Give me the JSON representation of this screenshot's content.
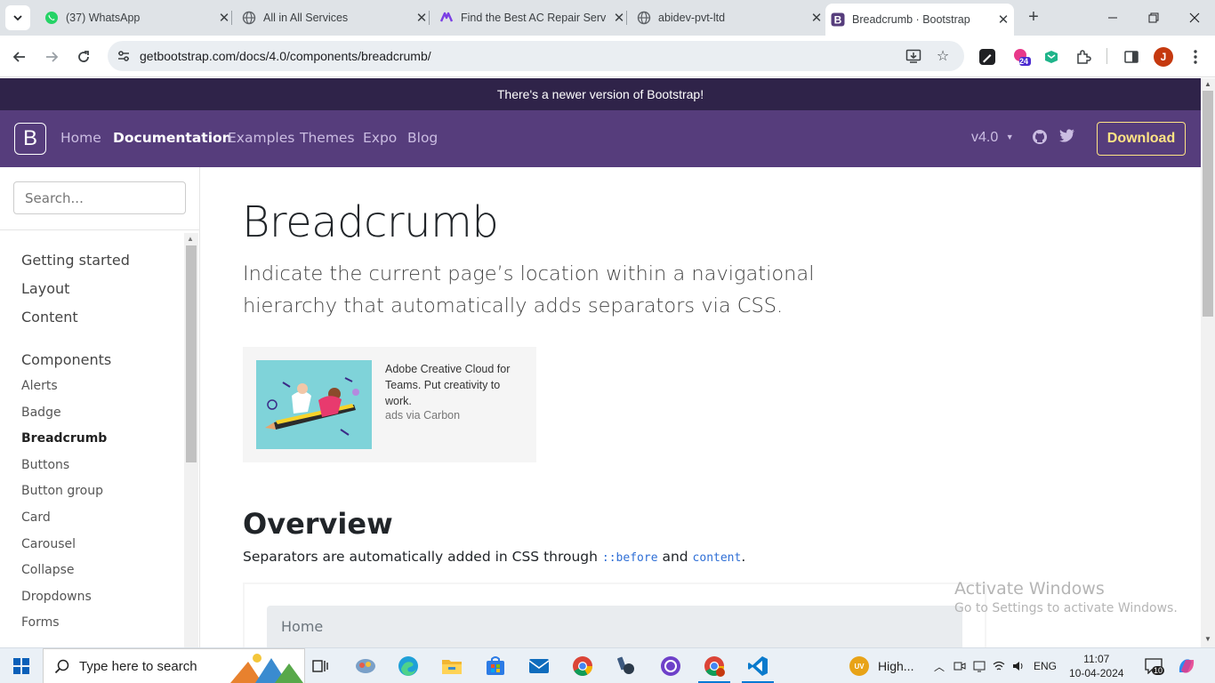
{
  "browser": {
    "tabs": [
      {
        "title": "(37) WhatsApp",
        "icon": "whatsapp-icon"
      },
      {
        "title": "All in All Services",
        "icon": "globe-icon"
      },
      {
        "title": "Find the Best AC Repair Servi",
        "icon": "brand-icon"
      },
      {
        "title": "abidev-pvt-ltd",
        "icon": "globe-icon"
      },
      {
        "title": "Breadcrumb · Bootstrap",
        "icon": "bootstrap-icon",
        "active": true
      }
    ],
    "url": "getbootstrap.com/docs/4.0/components/breadcrumb/",
    "extension_badge": "24",
    "profile_initial": "J"
  },
  "page": {
    "banner": "There's a newer version of Bootstrap!",
    "nav": {
      "logo": "B",
      "links": [
        "Home",
        "Documentation",
        "Examples",
        "Themes",
        "Expo",
        "Blog"
      ],
      "version": "v4.0",
      "download": "Download"
    },
    "sidebar": {
      "search_placeholder": "Search...",
      "sections": [
        "Getting started",
        "Layout",
        "Content",
        "Components"
      ],
      "items": [
        "Alerts",
        "Badge",
        "Breadcrumb",
        "Buttons",
        "Button group",
        "Card",
        "Carousel",
        "Collapse",
        "Dropdowns",
        "Forms"
      ],
      "active_item": "Breadcrumb"
    },
    "title": "Breadcrumb",
    "lead": "Indicate the current page’s location within a navigational hierarchy that automatically adds separators via CSS.",
    "ad": {
      "text": "Adobe Creative Cloud for Teams. Put creativity to work.",
      "via": "ads via Carbon"
    },
    "overview": {
      "heading": "Overview",
      "text_before": "Separators are automatically added in CSS through ",
      "code1": "::before",
      "text_mid": " and ",
      "code2": "content",
      "text_end": "."
    },
    "example_crumb": "Home"
  },
  "watermark": {
    "line1": "Activate Windows",
    "line2": "Go to Settings to activate Windows."
  },
  "taskbar": {
    "search_placeholder": "Type here to search",
    "weather": "High...",
    "language": "ENG",
    "time": "11:07",
    "date": "10-04-2024",
    "notifications": "10"
  }
}
